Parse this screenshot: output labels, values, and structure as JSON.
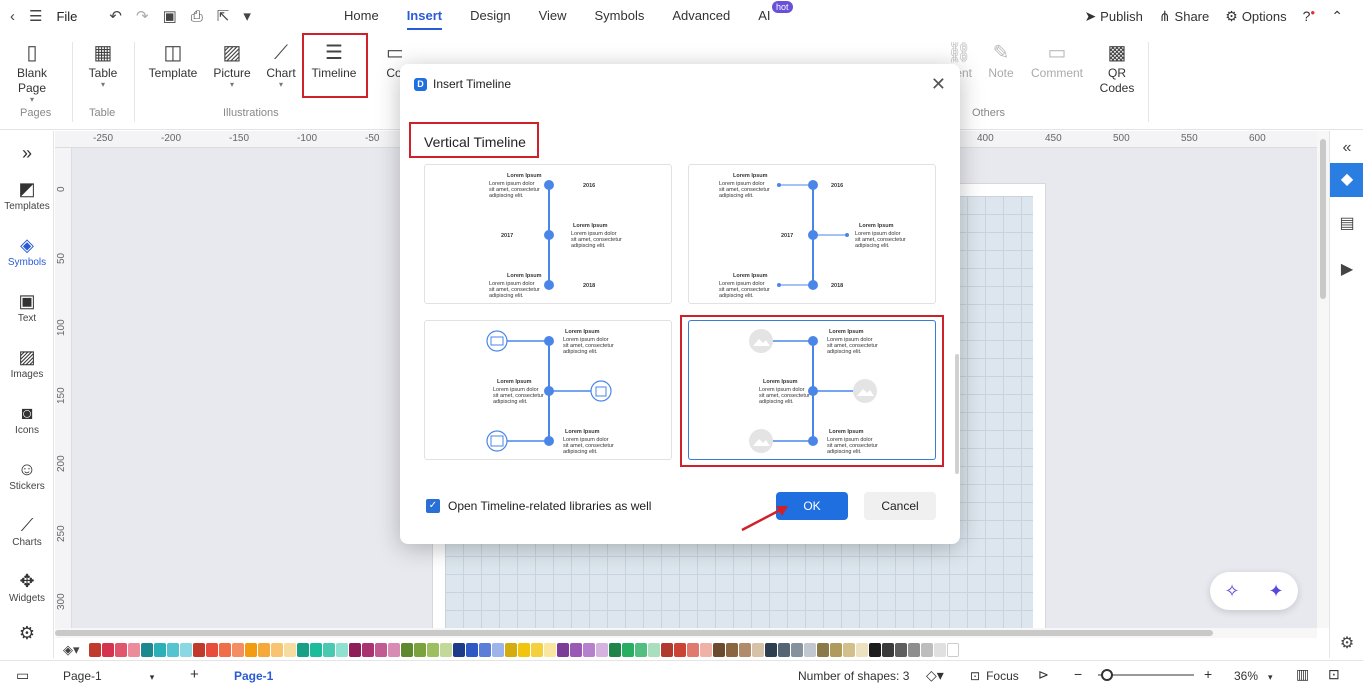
{
  "menubar": {
    "file_label": "File",
    "tabs": [
      "Home",
      "Insert",
      "Design",
      "View",
      "Symbols",
      "Advanced",
      "AI"
    ],
    "active_tab": "Insert",
    "hot_badge": "hot",
    "publish": "Publish",
    "share": "Share",
    "options": "Options"
  },
  "ribbon": {
    "blank_page": "Blank Page",
    "table": "Table",
    "template": "Template",
    "picture": "Picture",
    "chart": "Chart",
    "timeline": "Timeline",
    "co_partial": "Co",
    "ent_partial": "ent",
    "note": "Note",
    "comment": "Comment",
    "qr_codes": "QR Codes",
    "groups": {
      "pages": "Pages",
      "table": "Table",
      "illustrations": "Illustrations",
      "others": "Others"
    }
  },
  "ruler": {
    "top": [
      "-250",
      "-200",
      "-150",
      "-100",
      "-50",
      "400",
      "450",
      "500",
      "550",
      "600"
    ],
    "left": [
      "0",
      "50",
      "100",
      "150",
      "200",
      "250",
      "300"
    ]
  },
  "sidebar": {
    "items": [
      "Templates",
      "Symbols",
      "Text",
      "Images",
      "Icons",
      "Stickers",
      "Charts",
      "Widgets"
    ],
    "active": "Symbols"
  },
  "dialog": {
    "title": "Insert Timeline",
    "section": "Vertical Timeline",
    "lorem_title": "Lorem Ipsum",
    "lorem_l1": "Lorem ipsum dolor",
    "lorem_l2": "sit amet, consectetur",
    "lorem_l3": "adipiscing elit.",
    "years": [
      "2016",
      "2017",
      "2018"
    ],
    "checkbox_label": "Open Timeline-related libraries as well",
    "ok": "OK",
    "cancel": "Cancel"
  },
  "statusbar": {
    "page_tab": "Page-1",
    "active_page": "Page-1",
    "shapes": "Number of shapes: 3",
    "focus": "Focus",
    "zoom": "36%"
  },
  "colors": {
    "accent": "#1f6fe0",
    "highlight": "#d0202a",
    "timeline_blue": "#4a86e8",
    "swatches": [
      "#c0392b",
      "#d6334e",
      "#e0566c",
      "#ec8b9c",
      "#1b8a8f",
      "#2bb0b8",
      "#53c4d0",
      "#8ad8e4",
      "#c0392b",
      "#e74c3c",
      "#f06e4a",
      "#f58d63",
      "#f39c12",
      "#f6a93b",
      "#f8c471",
      "#f7dc9f",
      "#16a085",
      "#1abc9c",
      "#48c9b0",
      "#8ee0d0",
      "#8e1e5a",
      "#a93271",
      "#c25b91",
      "#d98cb3",
      "#5d8a2f",
      "#7aa33e",
      "#9dbf5f",
      "#c3d99a",
      "#1e3a8a",
      "#2e59c4",
      "#5b7fd8",
      "#9db4ea",
      "#d4ac0d",
      "#f1c40f",
      "#f4d03f",
      "#f9e79f",
      "#7d3c98",
      "#9b59b6",
      "#b780cc",
      "#d5b3e0",
      "#1e8449",
      "#27ae60",
      "#52be80",
      "#a9dfbf",
      "#b03a2e",
      "#cb4335",
      "#e07a6f",
      "#f0b1a9",
      "#6c4a2e",
      "#8b6440",
      "#b08c6a",
      "#d6c1a9",
      "#2c3e50",
      "#566573",
      "#85929e",
      "#c0c7cf",
      "#8a7a4a",
      "#b09a5c",
      "#d2c08a",
      "#ede2c0",
      "#1c1c1c",
      "#3a3a3a",
      "#5e5e5e",
      "#8e8e8e",
      "#bdbdbd",
      "#e0e0e0",
      "#ffffff"
    ]
  }
}
